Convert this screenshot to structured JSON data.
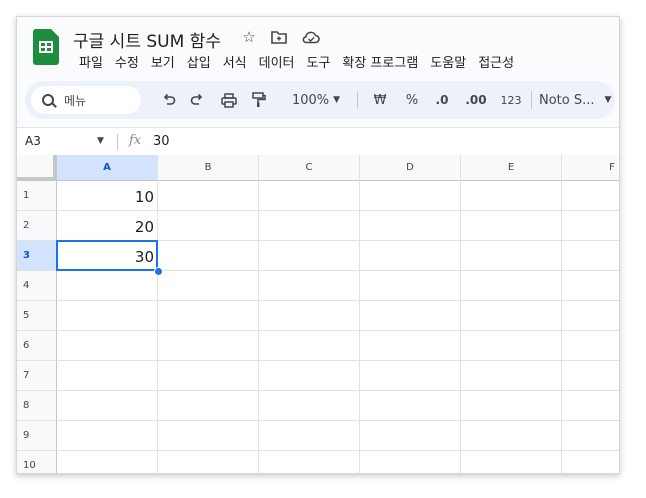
{
  "title": "구글 시트 SUM 함수",
  "title_icons": [
    "star-icon",
    "move-to-folder-icon",
    "cloud-saved-icon"
  ],
  "menu": [
    "파일",
    "수정",
    "보기",
    "삽입",
    "서식",
    "데이터",
    "도구",
    "확장 프로그램",
    "도움말",
    "접근성"
  ],
  "toolbar": {
    "search_label": "메뉴",
    "zoom": "100%",
    "currency": "₩",
    "percent": "%",
    "decrease_decimal": ".0",
    "increase_decimal": ".00",
    "number_format": "123",
    "font": "Noto S..."
  },
  "formula_bar": {
    "cell_ref": "A3",
    "fx": "fx",
    "value": "30"
  },
  "columns": [
    "A",
    "B",
    "C",
    "D",
    "E",
    "F"
  ],
  "rows": [
    "1",
    "2",
    "3",
    "4",
    "5",
    "6",
    "7",
    "8",
    "9",
    "10"
  ],
  "cells": {
    "A1": "10",
    "A2": "20",
    "A3": "30"
  },
  "selection": {
    "cell": "A3"
  },
  "colors": {
    "accent": "#1a73e8",
    "header_selected": "#d3e3fd",
    "toolbar_bg": "#edf2fa",
    "logo_green": "#1e8e3e"
  }
}
